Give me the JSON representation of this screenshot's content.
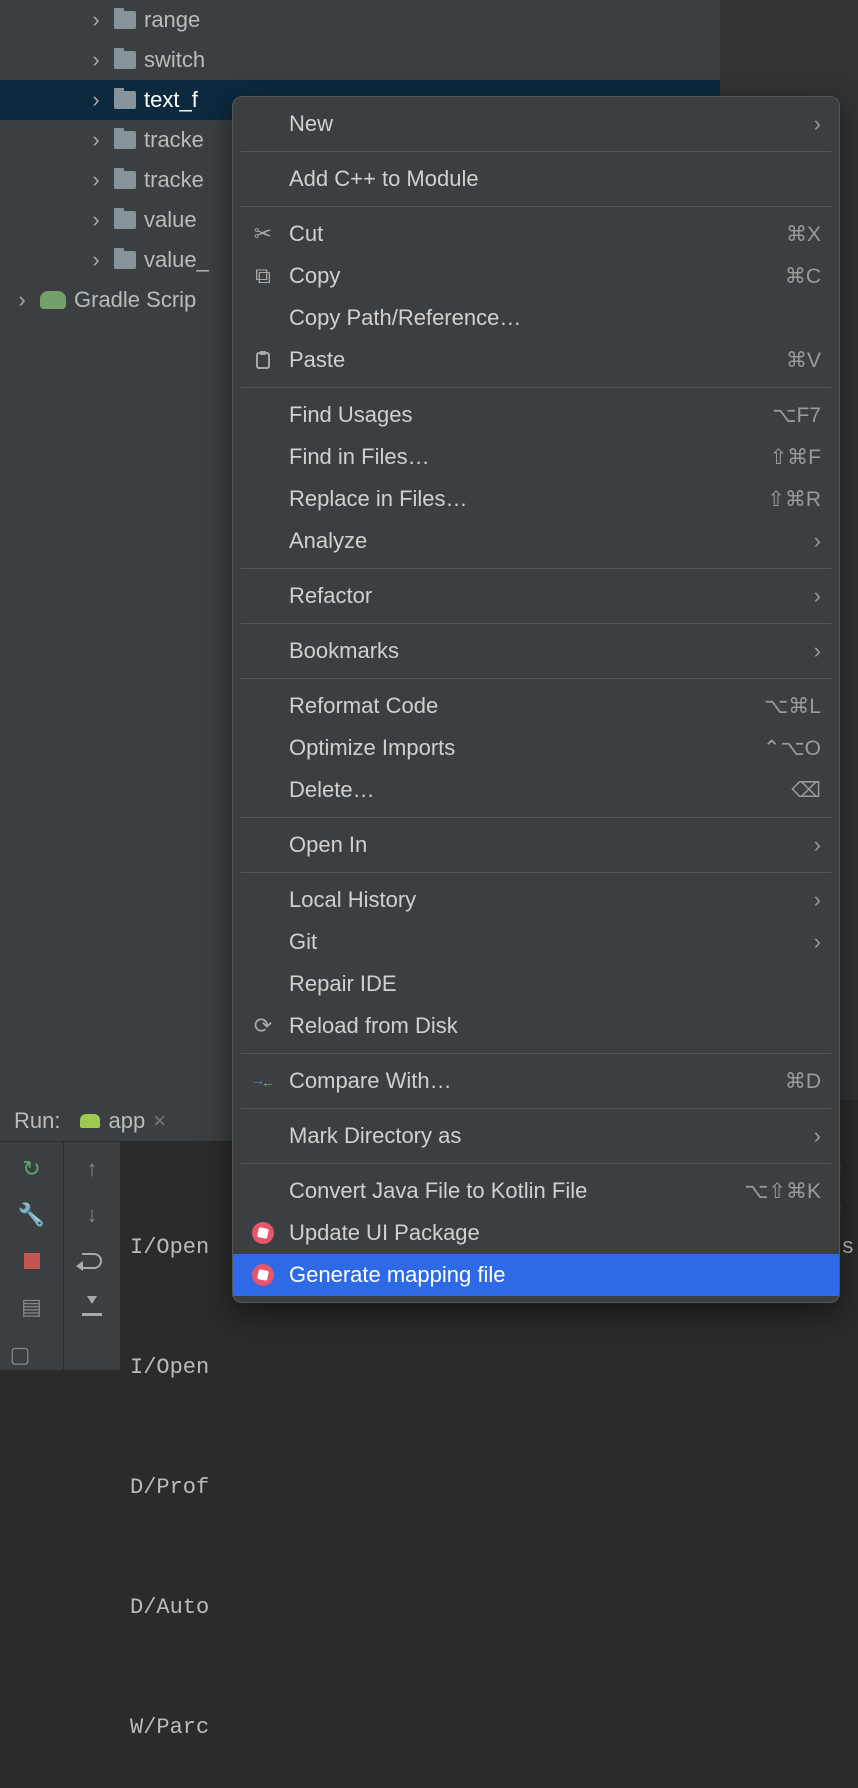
{
  "tree": {
    "items": [
      {
        "label": "range"
      },
      {
        "label": "switch"
      },
      {
        "label": "text_f"
      },
      {
        "label": "tracke"
      },
      {
        "label": "tracke"
      },
      {
        "label": "value"
      },
      {
        "label": "value_"
      }
    ],
    "gradle_label": "Gradle Scrip"
  },
  "run": {
    "title": "Run:",
    "tab": "app",
    "log_lines": [
      "I/Open",
      "I/Open",
      "D/Prof",
      "D/Auto",
      "W/Parc"
    ],
    "log_tail": [
      "m",
      "m",
      "",
      ".s",
      ""
    ]
  },
  "menu": {
    "groups": [
      [
        {
          "label": "New",
          "submenu": true
        }
      ],
      [
        {
          "label": "Add C++ to Module"
        }
      ],
      [
        {
          "label": "Cut",
          "icon": "cut",
          "shortcut": "⌘X"
        },
        {
          "label": "Copy",
          "icon": "copy",
          "shortcut": "⌘C"
        },
        {
          "label": "Copy Path/Reference…"
        },
        {
          "label": "Paste",
          "icon": "paste",
          "shortcut": "⌘V"
        }
      ],
      [
        {
          "label": "Find Usages",
          "shortcut": "⌥F7"
        },
        {
          "label": "Find in Files…",
          "shortcut": "⇧⌘F"
        },
        {
          "label": "Replace in Files…",
          "shortcut": "⇧⌘R"
        },
        {
          "label": "Analyze",
          "submenu": true
        }
      ],
      [
        {
          "label": "Refactor",
          "submenu": true
        }
      ],
      [
        {
          "label": "Bookmarks",
          "submenu": true
        }
      ],
      [
        {
          "label": "Reformat Code",
          "shortcut": "⌥⌘L"
        },
        {
          "label": "Optimize Imports",
          "shortcut": "⌃⌥O"
        },
        {
          "label": "Delete…",
          "shortcut_icon": "delete"
        }
      ],
      [
        {
          "label": "Open In",
          "submenu": true
        }
      ],
      [
        {
          "label": "Local History",
          "submenu": true
        },
        {
          "label": "Git",
          "submenu": true
        },
        {
          "label": "Repair IDE"
        },
        {
          "label": "Reload from Disk",
          "icon": "reload"
        }
      ],
      [
        {
          "label": "Compare With…",
          "icon": "compare",
          "shortcut": "⌘D"
        }
      ],
      [
        {
          "label": "Mark Directory as",
          "submenu": true
        }
      ],
      [
        {
          "label": "Convert Java File to Kotlin File",
          "shortcut": "⌥⇧⌘K"
        },
        {
          "label": "Update UI Package",
          "icon": "pink"
        },
        {
          "label": "Generate mapping file",
          "icon": "pink",
          "active": true
        }
      ]
    ]
  }
}
